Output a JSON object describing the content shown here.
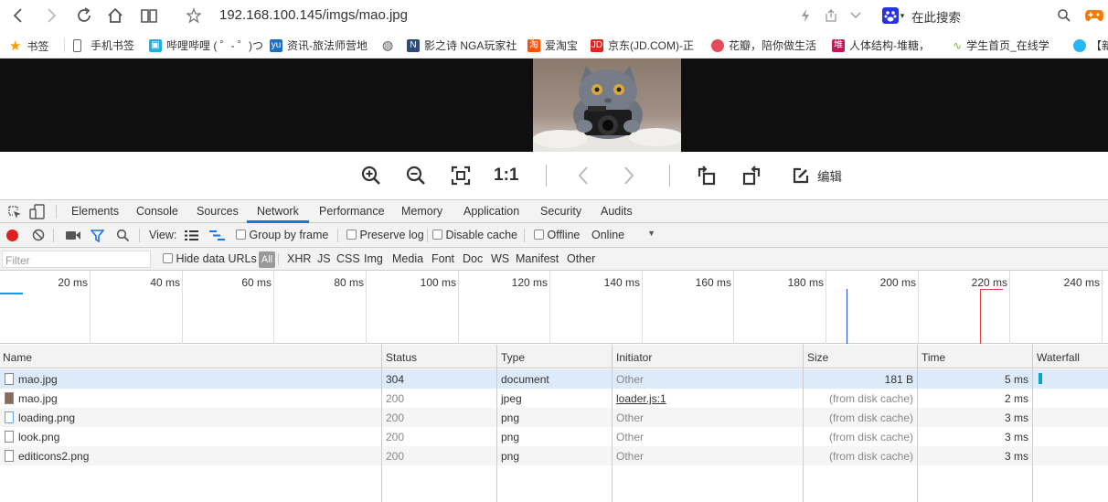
{
  "browser": {
    "url": "192.168.100.145/imgs/mao.jpg",
    "search_placeholder": "在此搜索",
    "bookmarks": [
      {
        "label": "书签",
        "icon": "star-icon",
        "color": "#f0a000"
      },
      {
        "label": "手机书签",
        "icon": "phone-icon",
        "color": "#666666"
      },
      {
        "label": "哔哩哔哩 ( ゜- ゜)つ",
        "icon": "bilibili-icon",
        "color": "#23ade5"
      },
      {
        "label": "资讯-旅法师营地",
        "icon": "yu-icon",
        "color": "#1b6fc6"
      },
      {
        "label": "",
        "icon": "globe-icon",
        "color": "#555555"
      },
      {
        "label": "影之诗 NGA玩家社",
        "icon": "nga-icon",
        "color": "#2b4b7a"
      },
      {
        "label": "爱淘宝",
        "icon": "taobao-icon",
        "color": "#ff5000"
      },
      {
        "label": "京东(JD.COM)-正",
        "icon": "jd-icon",
        "color": "#e1251b"
      },
      {
        "label": "花瓣，陪你做生活",
        "icon": "huaban-icon",
        "color": "#e54a5b"
      },
      {
        "label": "人体结构-堆糖，",
        "icon": "duitang-icon",
        "color": "#c2185b"
      },
      {
        "label": "学生首页_在线学",
        "icon": "wave-icon",
        "color": "#7cb342"
      },
      {
        "label": "【新",
        "icon": "globe2-icon",
        "color": "#29b6f6"
      }
    ]
  },
  "image_toolbar": {
    "ratio_label": "1:1",
    "edit_label": "编辑"
  },
  "devtools": {
    "tabs": [
      "Elements",
      "Console",
      "Sources",
      "Network",
      "Performance",
      "Memory",
      "Application",
      "Security",
      "Audits"
    ],
    "active_tab": "Network",
    "view_label": "View:",
    "group_by_frame": "Group by frame",
    "preserve_log": "Preserve log",
    "disable_cache": "Disable cache",
    "offline": "Offline",
    "throttle": "Online",
    "filter_placeholder": "Filter",
    "hide_data_urls": "Hide data URLs",
    "type_filters": [
      "All",
      "XHR",
      "JS",
      "CSS",
      "Img",
      "Media",
      "Font",
      "Doc",
      "WS",
      "Manifest",
      "Other"
    ],
    "timeline_ticks": [
      "20 ms",
      "40 ms",
      "60 ms",
      "80 ms",
      "100 ms",
      "120 ms",
      "140 ms",
      "160 ms",
      "180 ms",
      "200 ms",
      "220 ms",
      "240 ms"
    ],
    "columns": [
      "Name",
      "Status",
      "Type",
      "Initiator",
      "Size",
      "Time",
      "Waterfall"
    ],
    "rows": [
      {
        "name": "mao.jpg",
        "status": "304",
        "type": "document",
        "initiator": "Other",
        "size": "181 B",
        "time": "5 ms"
      },
      {
        "name": "mao.jpg",
        "status": "200",
        "type": "jpeg",
        "initiator": "loader.js:1",
        "size": "(from disk cache)",
        "time": "2 ms"
      },
      {
        "name": "loading.png",
        "status": "200",
        "type": "png",
        "initiator": "Other",
        "size": "(from disk cache)",
        "time": "3 ms"
      },
      {
        "name": "look.png",
        "status": "200",
        "type": "png",
        "initiator": "Other",
        "size": "(from disk cache)",
        "time": "3 ms"
      },
      {
        "name": "editicons2.png",
        "status": "200",
        "type": "png",
        "initiator": "Other",
        "size": "(from disk cache)",
        "time": "3 ms"
      }
    ]
  }
}
